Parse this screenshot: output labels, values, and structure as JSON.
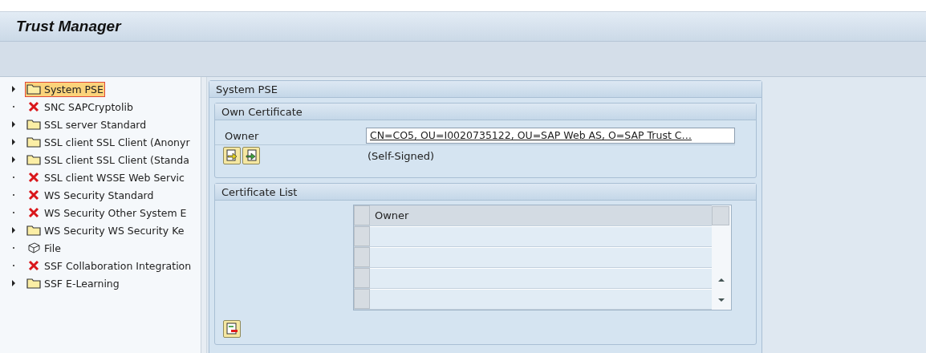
{
  "window": {
    "title": "Trust Manager"
  },
  "tree": {
    "items": [
      {
        "label": "System PSE",
        "kind": "folder",
        "expandable": true,
        "selected": true
      },
      {
        "label": "SNC SAPCryptolib",
        "kind": "error",
        "expandable": false,
        "selected": false
      },
      {
        "label": "SSL server Standard",
        "kind": "folder",
        "expandable": true,
        "selected": false
      },
      {
        "label": "SSL client SSL Client (Anonyr",
        "kind": "folder",
        "expandable": true,
        "selected": false
      },
      {
        "label": "SSL client SSL Client (Standa",
        "kind": "folder",
        "expandable": true,
        "selected": false
      },
      {
        "label": "SSL client WSSE Web Servic",
        "kind": "error",
        "expandable": false,
        "selected": false
      },
      {
        "label": "WS Security Standard",
        "kind": "error",
        "expandable": false,
        "selected": false
      },
      {
        "label": "WS Security Other System E",
        "kind": "error",
        "expandable": false,
        "selected": false
      },
      {
        "label": "WS Security WS Security Ke",
        "kind": "folder",
        "expandable": true,
        "selected": false
      },
      {
        "label": "File",
        "kind": "file",
        "expandable": false,
        "selected": false
      },
      {
        "label": "SSF Collaboration Integration",
        "kind": "error",
        "expandable": false,
        "selected": false
      },
      {
        "label": "SSF E-Learning",
        "kind": "folder",
        "expandable": true,
        "selected": false
      }
    ]
  },
  "panel": {
    "title": "System PSE",
    "own_certificate": {
      "title": "Own Certificate",
      "owner_label": "Owner",
      "owner_value": "CN=CO5, OU=I0020735122, OU=SAP Web AS, O=SAP Trust C…",
      "note": "(Self-Signed)"
    },
    "certificate_list": {
      "title": "Certificate List",
      "columns": [
        "Owner"
      ]
    }
  }
}
